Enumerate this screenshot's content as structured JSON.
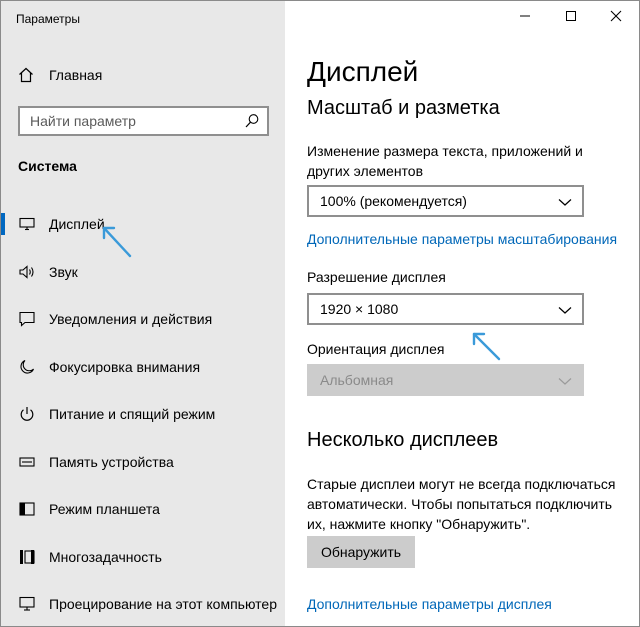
{
  "window": {
    "title": "Параметры",
    "controls": [
      "minimize-icon",
      "maximize-icon",
      "close-icon"
    ]
  },
  "sidebar": {
    "home_label": "Главная",
    "search_placeholder": "Найти параметр",
    "section_title": "Система",
    "items": [
      {
        "label": "Дисплей",
        "icon": "monitor-icon",
        "active": true
      },
      {
        "label": "Звук",
        "icon": "speaker-icon",
        "active": false
      },
      {
        "label": "Уведомления и действия",
        "icon": "notification-icon",
        "active": false
      },
      {
        "label": "Фокусировка внимания",
        "icon": "moon-icon",
        "active": false
      },
      {
        "label": "Питание и спящий режим",
        "icon": "power-icon",
        "active": false
      },
      {
        "label": "Память устройства",
        "icon": "storage-icon",
        "active": false
      },
      {
        "label": "Режим планшета",
        "icon": "tablet-icon",
        "active": false
      },
      {
        "label": "Многозадачность",
        "icon": "multitask-icon",
        "active": false
      },
      {
        "label": "Проецирование на этот компьютер",
        "icon": "projection-icon",
        "active": false
      }
    ]
  },
  "main": {
    "page_title": "Дисплей",
    "scale_section": {
      "title": "Масштаб и разметка",
      "scale_label": "Изменение размера текста, приложений и других элементов",
      "scale_value": "100% (рекомендуется)",
      "advanced_scale_link": "Дополнительные параметры масштабирования",
      "resolution_label": "Разрешение дисплея",
      "resolution_value": "1920 × 1080",
      "orientation_label": "Ориентация дисплея",
      "orientation_value": "Альбомная",
      "orientation_disabled": true
    },
    "multi_section": {
      "title": "Несколько дисплеев",
      "description": "Старые дисплеи могут не всегда подключаться автоматически. Чтобы попытаться подключить их, нажмите кнопку \"Обнаружить\".",
      "detect_button": "Обнаружить",
      "advanced_display_link": "Дополнительные параметры дисплея"
    }
  },
  "colors": {
    "sidebar_bg": "#e8e8e8",
    "accent": "#0067c0",
    "link": "#0067b8",
    "annotation_arrow": "#3a9ad9"
  }
}
